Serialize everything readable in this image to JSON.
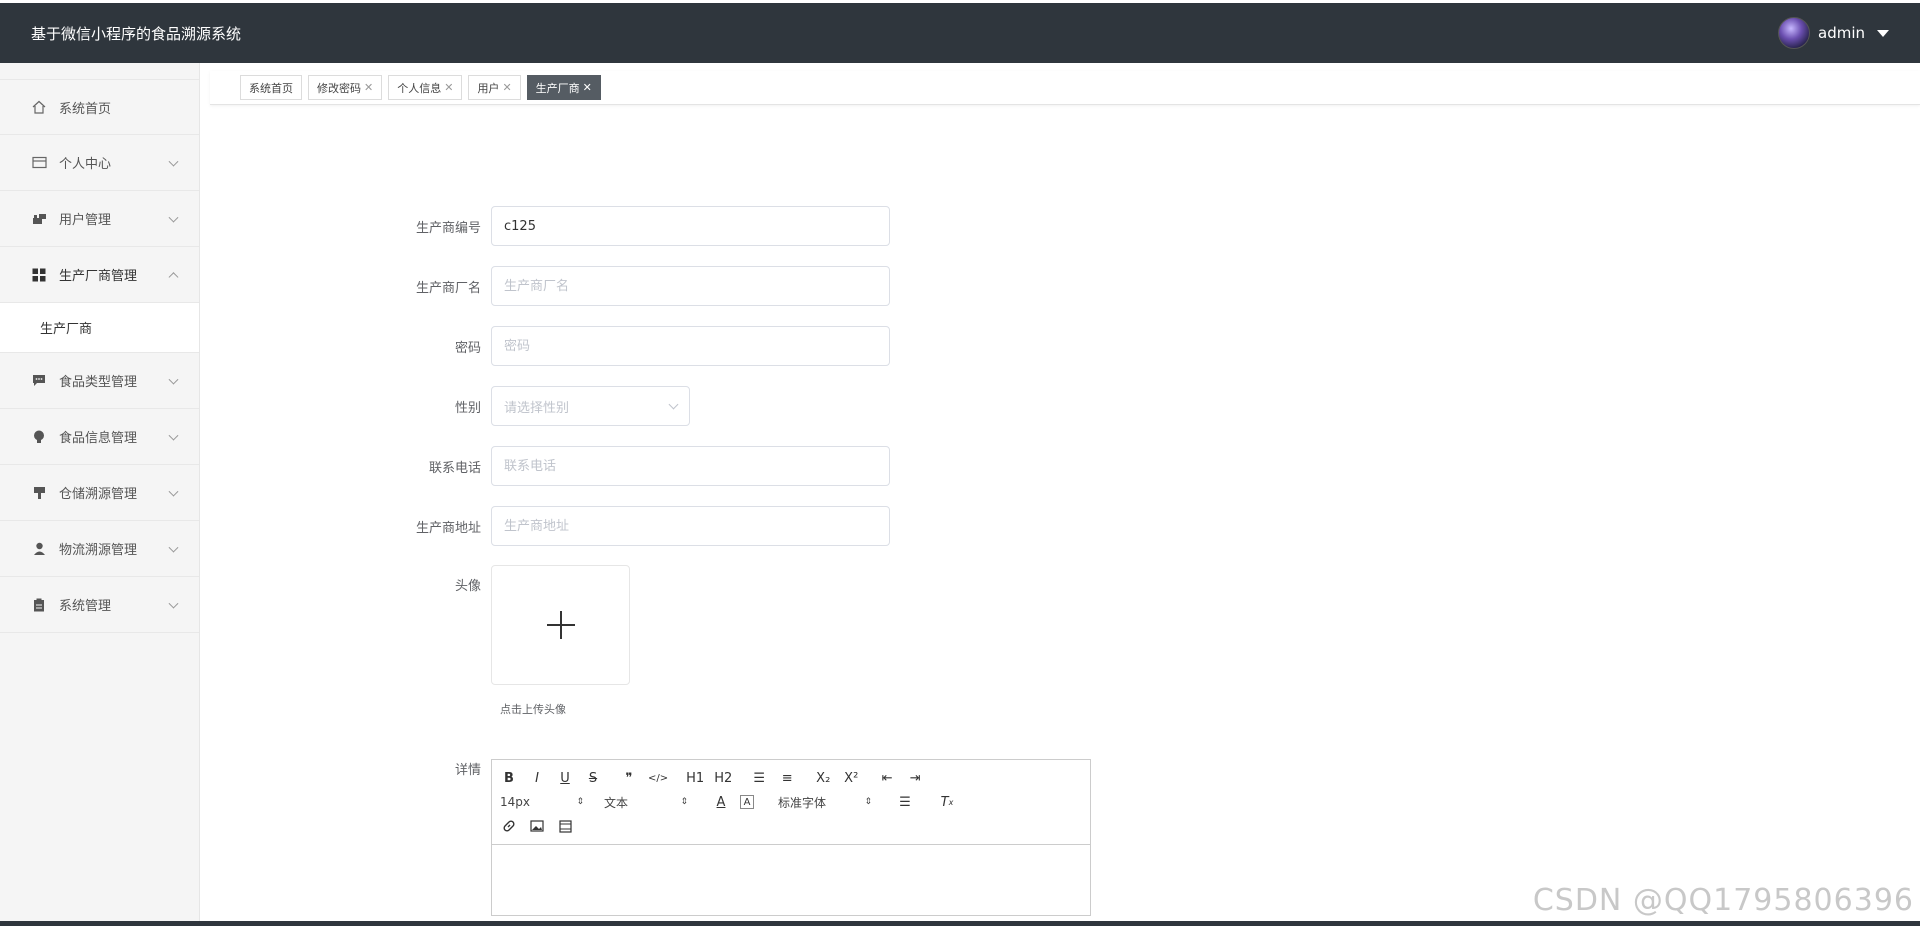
{
  "header": {
    "title": "基于微信小程序的食品溯源系统",
    "username": "admin"
  },
  "sidebar": {
    "items": [
      {
        "label": "系统首页",
        "icon": "home-icon"
      },
      {
        "label": "个人中心",
        "icon": "card-icon"
      },
      {
        "label": "用户管理",
        "icon": "user-manage-icon"
      },
      {
        "label": "生产厂商管理",
        "icon": "grid-icon"
      },
      {
        "label": "食品类型管理",
        "icon": "chat-icon"
      },
      {
        "label": "食品信息管理",
        "icon": "bulb-icon"
      },
      {
        "label": "仓储溯源管理",
        "icon": "stamp-icon"
      },
      {
        "label": "物流溯源管理",
        "icon": "person-icon"
      },
      {
        "label": "系统管理",
        "icon": "clipboard-icon"
      }
    ],
    "submenu": {
      "label": "生产厂商"
    }
  },
  "tabs": [
    {
      "label": "系统首页",
      "closable": false
    },
    {
      "label": "修改密码",
      "closable": true
    },
    {
      "label": "个人信息",
      "closable": true
    },
    {
      "label": "用户",
      "closable": true
    },
    {
      "label": "生产厂商",
      "closable": true,
      "active": true
    }
  ],
  "form": {
    "code": {
      "label": "生产商编号",
      "value": "c125"
    },
    "name": {
      "label": "生产商厂名",
      "placeholder": "生产商厂名"
    },
    "password": {
      "label": "密码",
      "placeholder": "密码"
    },
    "gender": {
      "label": "性别",
      "placeholder": "请选择性别"
    },
    "phone": {
      "label": "联系电话",
      "placeholder": "联系电话"
    },
    "address": {
      "label": "生产商地址",
      "placeholder": "生产商地址"
    },
    "avatar": {
      "label": "头像",
      "hint": "点击上传头像"
    },
    "detail": {
      "label": "详情"
    }
  },
  "editor": {
    "size": "14px",
    "header": "文本",
    "font": "标准字体",
    "buttons_row1": [
      "B",
      "I",
      "U",
      "S",
      "❞",
      "</>",
      "H1",
      "H2",
      "☰",
      "≡",
      "X₂",
      "X²",
      "⇤",
      "⇥"
    ]
  },
  "watermark": "CSDN @QQ1795806396"
}
